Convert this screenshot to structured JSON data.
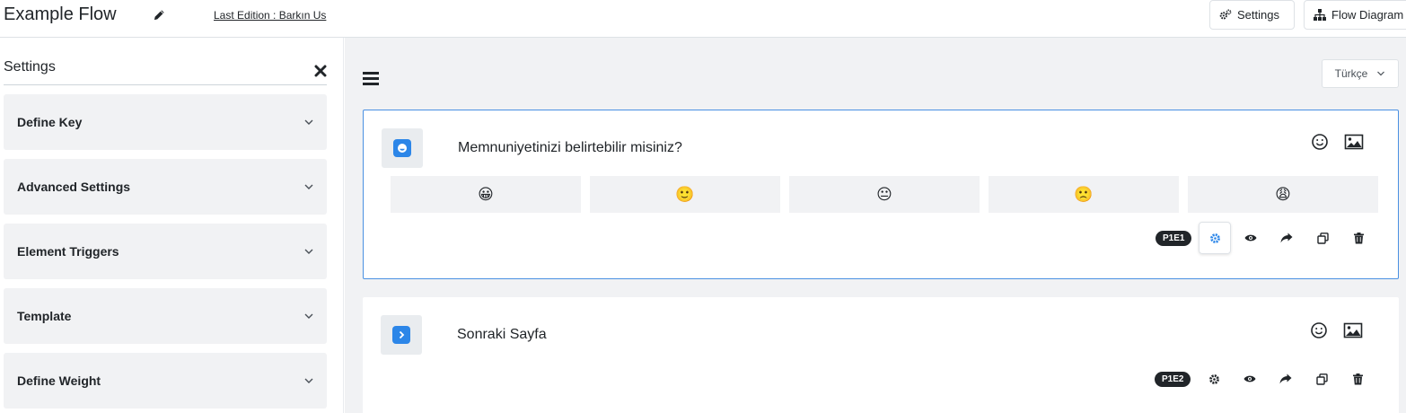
{
  "header": {
    "flow_title": "Example Flow",
    "last_edition": "Last Edition : Barkın Us",
    "settings_label": "Settings",
    "flow_diagram_label": "Flow Diagram"
  },
  "sidebar": {
    "title": "Settings",
    "items": [
      {
        "label": "Define Key"
      },
      {
        "label": "Advanced Settings"
      },
      {
        "label": "Element Triggers"
      },
      {
        "label": "Template"
      },
      {
        "label": "Define Weight"
      }
    ]
  },
  "main": {
    "language": "Türkçe",
    "cards": [
      {
        "question": "Memnuniyetinizi belirtebilir misiniz?",
        "badge": "P1E1",
        "emojis": [
          "😀",
          "🙂",
          "😐",
          "🙁",
          "😩"
        ]
      },
      {
        "question": "Sonraki Sayfa",
        "badge": "P1E2"
      }
    ]
  },
  "colors": {
    "accent": "#2c86e8",
    "active_border": "#4a90e2",
    "panel_bg": "#f1f2f4",
    "badge_bg": "#212529"
  }
}
